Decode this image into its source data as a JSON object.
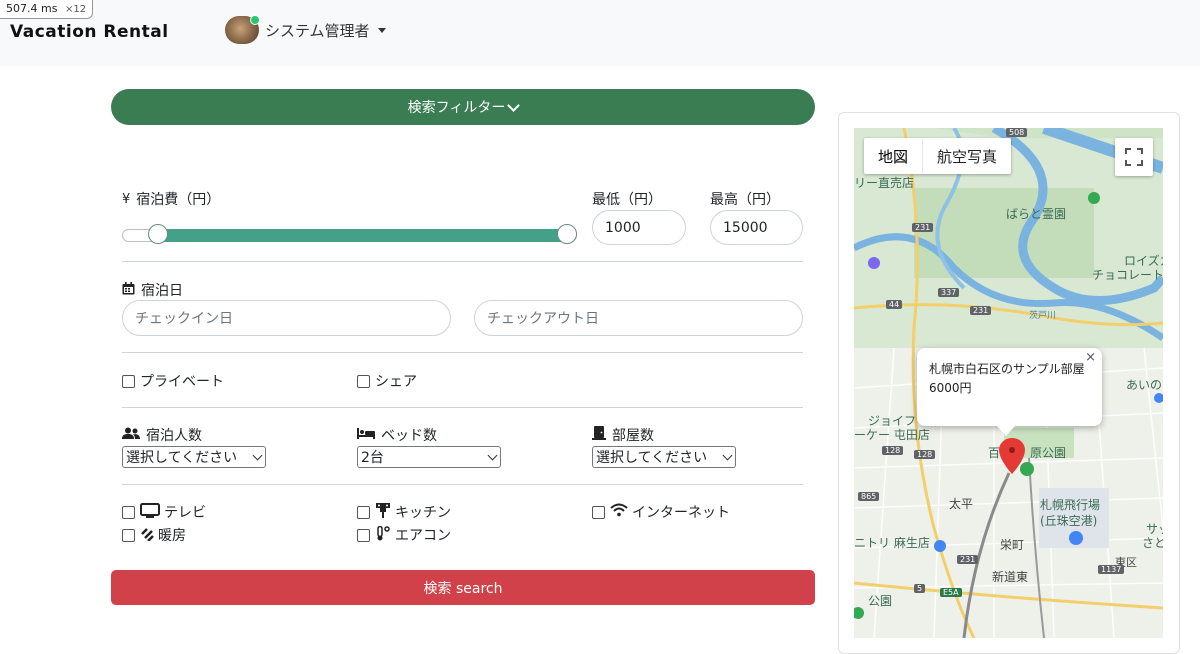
{
  "devtools": {
    "timing": "507.4",
    "unit": "ms",
    "multiplier": "×12"
  },
  "navbar": {
    "brand": "Vacation Rental",
    "user_name": "システム管理者"
  },
  "filter": {
    "toggle_label": "検索フィルター",
    "price": {
      "label": "宿泊費（円）",
      "min_label": "最低（円）",
      "max_label": "最高（円）",
      "min_value": "1000",
      "max_value": "15000",
      "range_min_fraction": 0.06,
      "range_max_fraction": 1.0
    },
    "dates": {
      "label": "宿泊日",
      "checkin_placeholder": "チェックイン日",
      "checkout_placeholder": "チェックアウト日"
    },
    "type": {
      "private_label": "プライベート",
      "share_label": "シェア",
      "private_checked": false,
      "share_checked": false
    },
    "counts": {
      "guests_label": "宿泊人数",
      "guests_value": "選択してください",
      "beds_label": "ベッド数",
      "beds_value": "2台",
      "rooms_label": "部屋数",
      "rooms_value": "選択してください"
    },
    "amenities": {
      "tv": "テレビ",
      "kitchen": "キッチン",
      "internet": "インターネット",
      "heating": "暖房",
      "aircon": "エアコン"
    },
    "search_label": "検索 search"
  },
  "map": {
    "map_button": "地図",
    "satellite_button": "航空写真",
    "info_title": "札幌市白石区のサンプル部屋",
    "info_price": "6000円",
    "close_glyph": "×",
    "labels": {
      "l1": "リー直売店",
      "l2": "ばらと霊園",
      "l3": "ロイズカ",
      "l4": "チョコレート",
      "l5": "茨戸川",
      "l6": "あいの",
      "l7": "ジョイフ",
      "l8": "ーケー 屯田店",
      "l9": "百",
      "l10": "原公園",
      "l11": "太平",
      "l12": "札幌飛行場",
      "l13": "(丘珠空港)",
      "l14": "ニトリ 麻生店",
      "l15": "栄町",
      "l16": "東区",
      "l17": "新道東",
      "l18": "サッ",
      "l19": "さとら",
      "l20": "公園",
      "r508": "508",
      "r231a": "231",
      "r231b": "231",
      "r231c": "231",
      "r337": "337",
      "r44": "44",
      "r128a": "128",
      "r128b": "128",
      "r865": "865",
      "r1137": "1137",
      "r5": "5",
      "rE5A": "E5A"
    }
  },
  "colors": {
    "toggle": "#3a7d52",
    "slider": "#45a08a",
    "search": "#d0414a",
    "pin": "#e53935"
  }
}
